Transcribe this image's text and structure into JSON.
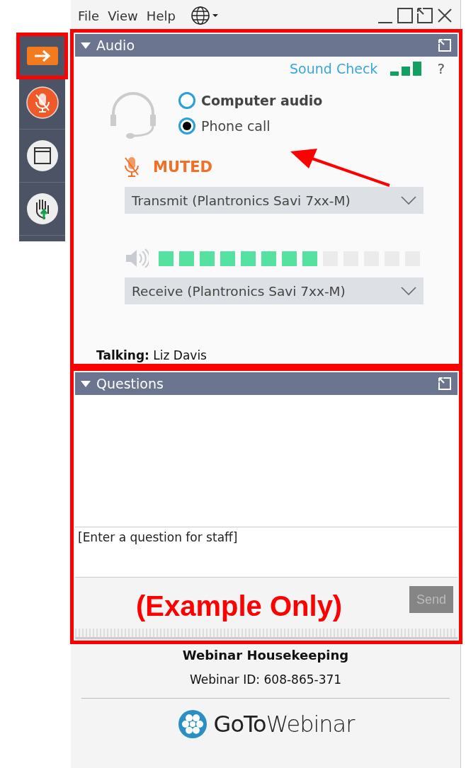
{
  "menu": {
    "items": [
      "File",
      "View",
      "Help"
    ]
  },
  "sidebar": {
    "items": [
      {
        "kind": "arrow",
        "selected": true
      },
      {
        "kind": "mic",
        "selected": false
      },
      {
        "kind": "window",
        "selected": false
      },
      {
        "kind": "hand",
        "selected": false
      }
    ]
  },
  "audio": {
    "title": "Audio",
    "sound_check": "Sound Check",
    "help": "?",
    "options": [
      {
        "label": "Computer audio",
        "selected": false,
        "bold": true
      },
      {
        "label": "Phone call",
        "selected": true,
        "bold": false
      }
    ],
    "muted": true,
    "muted_label": "MUTED",
    "transmit": "Transmit (Plantronics Savi 7xx-M)",
    "level": 0.615,
    "receive": "Receive (Plantronics Savi 7xx-M)",
    "talking": "**Talking:** Liz Davis"
  },
  "questions": {
    "title": "Questions",
    "placeholder": "[Enter a question for staff]",
    "send": "Send",
    "send_disabled": true
  },
  "annotation": {
    "label": "(Example Only)"
  },
  "footer": {
    "title": "Webinar Housekeeping",
    "webinar_id": "Webinar ID: 608-865-371",
    "logo": "**GoTo**Webinar"
  }
}
